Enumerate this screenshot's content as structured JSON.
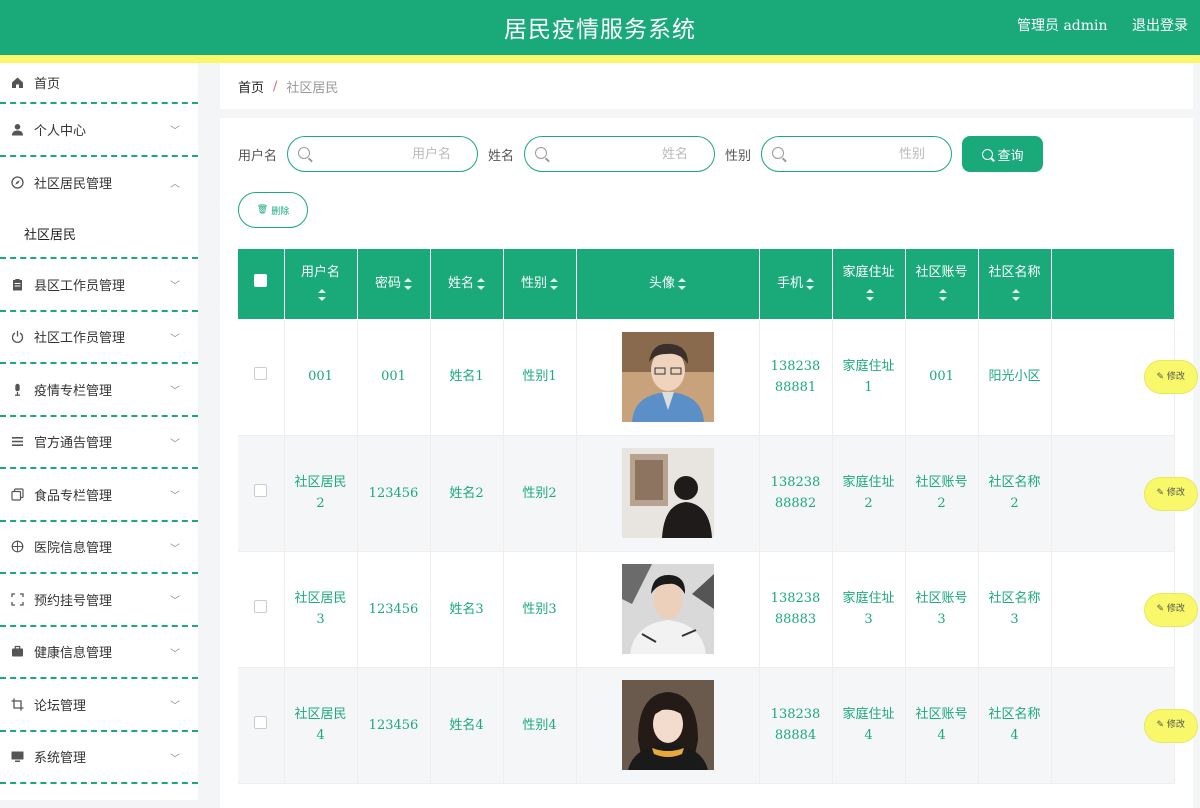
{
  "header": {
    "title": "居民疫情服务系统",
    "admin": "管理员 admin",
    "logout": "退出登录"
  },
  "sidebar": {
    "items": [
      {
        "label": "首页",
        "icon": "home-icon"
      },
      {
        "label": "个人中心",
        "icon": "user-icon"
      },
      {
        "label": "社区居民管理",
        "icon": "compass-icon",
        "sub": "社区居民"
      },
      {
        "label": "县区工作员管理",
        "icon": "clipboard-icon"
      },
      {
        "label": "社区工作员管理",
        "icon": "power-icon"
      },
      {
        "label": "疫情专栏管理",
        "icon": "microphone-icon"
      },
      {
        "label": "官方通告管理",
        "icon": "list-icon"
      },
      {
        "label": "食品专栏管理",
        "icon": "copy-icon"
      },
      {
        "label": "医院信息管理",
        "icon": "crosshair-icon"
      },
      {
        "label": "预约挂号管理",
        "icon": "scan-icon"
      },
      {
        "label": "健康信息管理",
        "icon": "briefcase-icon"
      },
      {
        "label": "论坛管理",
        "icon": "crop-icon"
      },
      {
        "label": "系统管理",
        "icon": "monitor-icon"
      }
    ]
  },
  "breadcrumb": {
    "home": "首页",
    "sep": "/",
    "current": "社区居民"
  },
  "search": {
    "username_label": "用户名",
    "username_placeholder": "用户名",
    "name_label": "姓名",
    "name_placeholder": "姓名",
    "gender_label": "性别",
    "gender_placeholder": "性别",
    "query_label": "查询"
  },
  "actions": {
    "delete_label": "删除",
    "edit_label": "修改"
  },
  "table": {
    "headers": [
      "用户名",
      "密码",
      "姓名",
      "性别",
      "头像",
      "手机",
      "家庭住址",
      "社区账号",
      "社区名称"
    ],
    "rows": [
      {
        "username": "001",
        "password": "001",
        "name": "姓名1",
        "gender": "性别1",
        "phone": "13823888881",
        "address": "家庭住址1",
        "account": "001",
        "community": "阳光小区"
      },
      {
        "username": "社区居民2",
        "password": "123456",
        "name": "姓名2",
        "gender": "性别2",
        "phone": "13823888882",
        "address": "家庭住址2",
        "account": "社区账号2",
        "community": "社区名称2"
      },
      {
        "username": "社区居民3",
        "password": "123456",
        "name": "姓名3",
        "gender": "性别3",
        "phone": "13823888883",
        "address": "家庭住址3",
        "account": "社区账号3",
        "community": "社区名称3"
      },
      {
        "username": "社区居民4",
        "password": "123456",
        "name": "姓名4",
        "gender": "性别4",
        "phone": "13823888884",
        "address": "家庭住址4",
        "account": "社区账号4",
        "community": "社区名称4"
      }
    ]
  },
  "colors": {
    "primary": "#1aaa7a",
    "accent": "#f8f86a"
  }
}
